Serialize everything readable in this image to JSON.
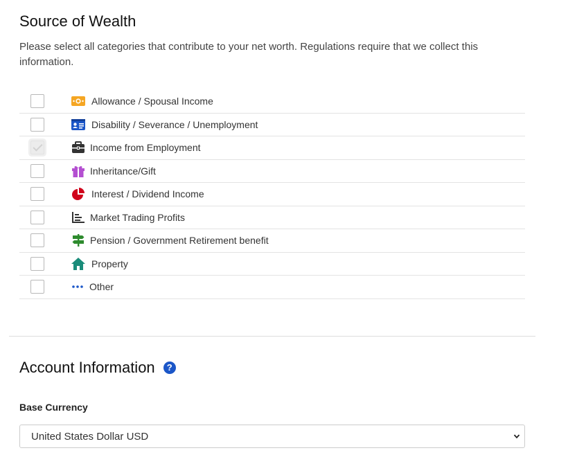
{
  "source_of_wealth": {
    "title": "Source of Wealth",
    "description": "Please select all categories that contribute to your net worth. Regulations require that we collect this information.",
    "items": [
      {
        "label": "Allowance / Spousal Income",
        "icon": "money-bill-icon",
        "checked": false,
        "icon_color": "#f5a623"
      },
      {
        "label": "Disability / Severance / Unemployment",
        "icon": "id-card-icon",
        "checked": false,
        "icon_color": "#1b56c8"
      },
      {
        "label": "Income from Employment",
        "icon": "briefcase-icon",
        "checked": true,
        "icon_color": "#333333"
      },
      {
        "label": "Inheritance/Gift",
        "icon": "gift-icon",
        "checked": false,
        "icon_color": "#b44fd1"
      },
      {
        "label": "Interest / Dividend Income",
        "icon": "pie-chart-icon",
        "checked": false,
        "icon_color": "#d0021b"
      },
      {
        "label": "Market Trading Profits",
        "icon": "bar-chart-icon",
        "checked": false,
        "icon_color": "#333333"
      },
      {
        "label": "Pension / Government Retirement benefit",
        "icon": "signpost-icon",
        "checked": false,
        "icon_color": "#2e8b2e"
      },
      {
        "label": "Property",
        "icon": "home-icon",
        "checked": false,
        "icon_color": "#1a8c7a"
      },
      {
        "label": "Other",
        "icon": "ellipsis-icon",
        "checked": false,
        "icon_color": "#1b56c8"
      }
    ]
  },
  "account_information": {
    "title": "Account Information",
    "help_glyph": "?",
    "base_currency": {
      "label": "Base Currency",
      "value": "United States Dollar USD"
    }
  },
  "colors": {
    "help_icon": "#1b56c8",
    "divider": "#dddddd"
  }
}
